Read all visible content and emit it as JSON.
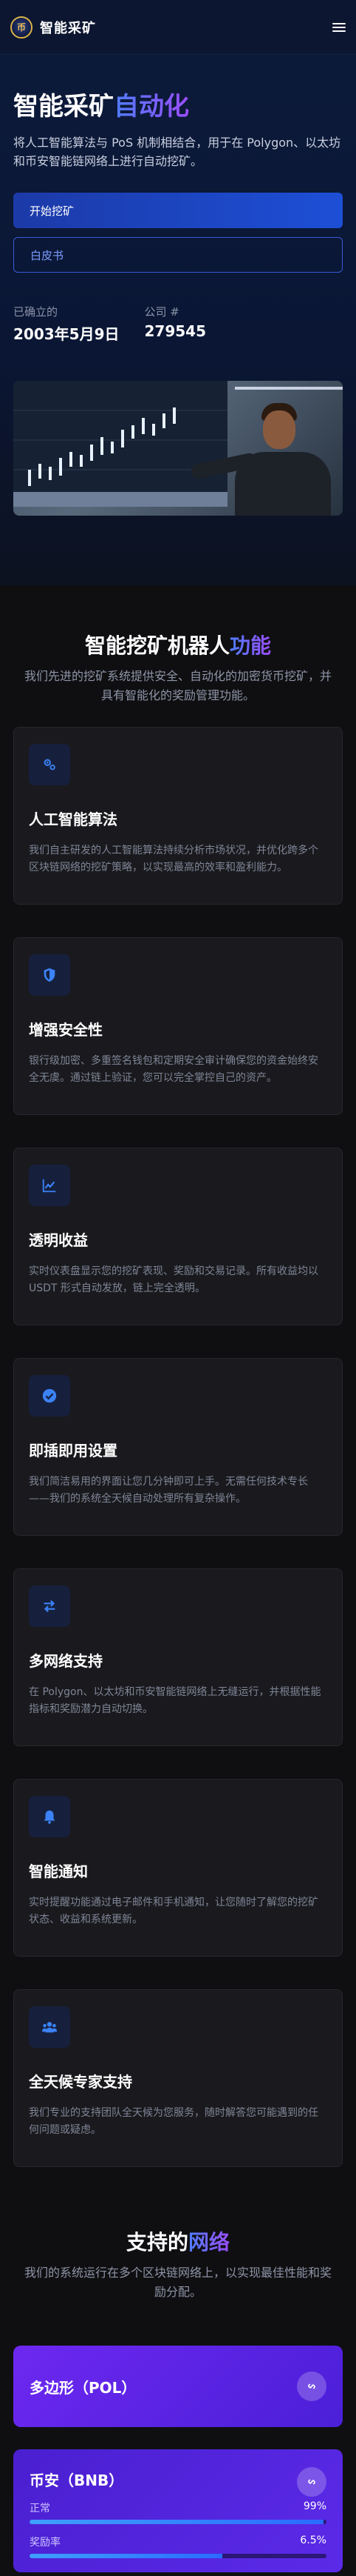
{
  "header": {
    "logo_text": "币",
    "brand": "智能采矿"
  },
  "hero": {
    "title_main": "智能采矿",
    "title_accent": "自动化",
    "description": "将人工智能算法与 PoS 机制相结合，用于在 Polygon、以太坊和币安智能链网络上进行自动挖矿。",
    "primary_button": "开始挖矿",
    "secondary_button": "白皮书",
    "stats": [
      {
        "label": "已确立的",
        "value": "2003年5月9日"
      },
      {
        "label": "公司 #",
        "value": "279545"
      }
    ]
  },
  "features": {
    "title_main": "智能挖矿机器人",
    "title_accent": "功能",
    "subtitle": "我们先进的挖矿系统提供安全、自动化的加密货币挖矿，并具有智能化的奖励管理功能。",
    "items": [
      {
        "icon": "gears-icon",
        "title": "人工智能算法",
        "desc": "我们自主研发的人工智能算法持续分析市场状况，并优化跨多个区块链网络的挖矿策略，以实现最高的效率和盈利能力。"
      },
      {
        "icon": "shield-icon",
        "title": "增强安全性",
        "desc": "银行级加密、多重签名钱包和定期安全审计确保您的资金始终安全无虞。通过链上验证，您可以完全掌控自己的资产。"
      },
      {
        "icon": "chart-line-icon",
        "title": "透明收益",
        "desc": "实时仪表盘显示您的挖矿表现、奖励和交易记录。所有收益均以 USDT 形式自动发放，链上完全透明。"
      },
      {
        "icon": "check-circle-icon",
        "title": "即插即用设置",
        "desc": "我们简洁易用的界面让您几分钟即可上手。无需任何技术专长——我们的系统全天候自动处理所有复杂操作。"
      },
      {
        "icon": "exchange-icon",
        "title": "多网络支持",
        "desc": "在 Polygon、以太坊和币安智能链网络上无缝运行，并根据性能指标和奖励潜力自动切换。"
      },
      {
        "icon": "bell-icon",
        "title": "智能通知",
        "desc": "实时提醒功能通过电子邮件和手机通知，让您随时了解您的挖矿状态、收益和系统更新。"
      },
      {
        "icon": "users-icon",
        "title": "全天候专家支持",
        "desc": "我们专业的支持团队全天候为您服务，随时解答您可能遇到的任何问题或疑虑。"
      }
    ]
  },
  "networks": {
    "title_main": "支持的",
    "title_accent": "网络",
    "subtitle": "我们的系统运行在多个区块链网络上，以实现最佳性能和奖励分配。",
    "items": [
      {
        "name": "多边形（POL）"
      },
      {
        "name": "币安（BNB）",
        "metrics": [
          {
            "label": "正常",
            "value": "99%",
            "fill": 0.99
          },
          {
            "label": "奖励率",
            "value": "6.5%",
            "fill": 0.65
          }
        ]
      }
    ]
  },
  "colors": {
    "accent_blue": "#4f7dff",
    "accent_purple": "#9b4dff",
    "card_purple": "#6d28f0",
    "icon_blue": "#3b82f6"
  }
}
